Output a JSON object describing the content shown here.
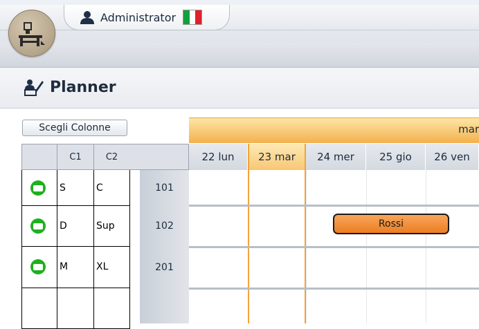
{
  "top": {
    "user_name": "Administrator",
    "flag_colors": [
      "#13a03a",
      "#ffffff",
      "#e0202a"
    ],
    "accent": "#f3a33a"
  },
  "header": {
    "title": "Planner"
  },
  "toolbar": {
    "choose_columns_label": "Scegli Colonne"
  },
  "grid": {
    "column_headers": [
      "C1",
      "C2"
    ],
    "month_label": "marz",
    "days": [
      "22 lun",
      "23 mar",
      "24 mer",
      "25 gio",
      "26 ven"
    ],
    "today_index": 1,
    "rows": [
      {
        "status": "occupied",
        "c1": "S",
        "c2": "C",
        "room": "101"
      },
      {
        "status": "occupied",
        "c1": "D",
        "c2": "Sup",
        "room": "102"
      },
      {
        "status": "occupied",
        "c1": "M",
        "c2": "XL",
        "room": "201"
      },
      {
        "status": "",
        "c1": "",
        "c2": "",
        "room": ""
      }
    ],
    "bookings": [
      {
        "guest": "Rossi",
        "room": "102",
        "color": "#ec7e22"
      }
    ]
  }
}
